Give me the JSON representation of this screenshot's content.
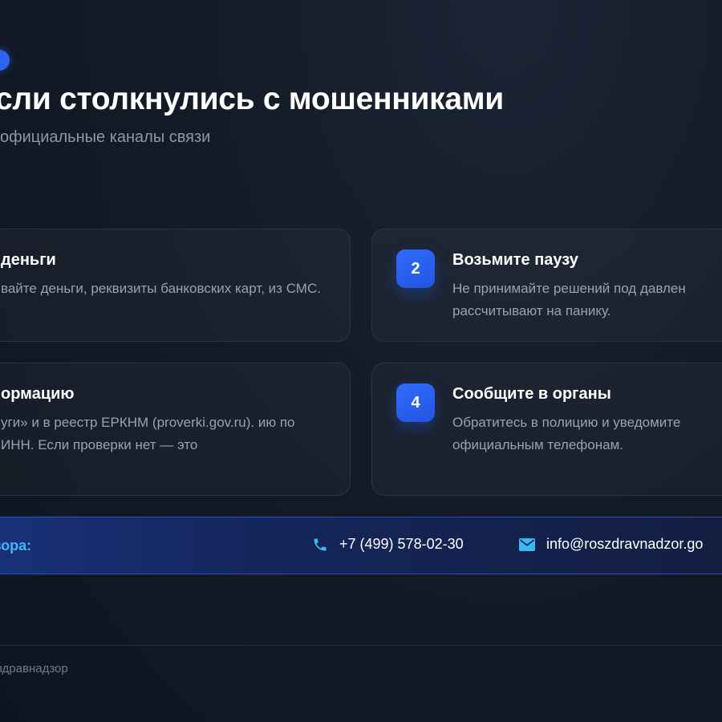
{
  "header": {
    "title": "сли столкнулись с мошенниками",
    "subtitle": "официальные каналы связи"
  },
  "cards": [
    {
      "number": "",
      "title": "деньги",
      "text": "вайте деньги, реквизиты банковских карт, из СМС."
    },
    {
      "number": "2",
      "title": "Возьмите паузу",
      "text_line_1": "Не принимайте решений под давлен",
      "text_line_2": "рассчитывают на панику."
    },
    {
      "number": "",
      "title": "ормацию",
      "text": "уги» и в реестр ЕРКНМ (proverki.gov.ru). ию по ИНН. Если проверки нет — это"
    },
    {
      "number": "4",
      "title": "Сообщите в органы",
      "text_line_1": "Обратитесь в полицию и уведомите",
      "text_line_2": "официальным телефонам."
    }
  ],
  "contacts": {
    "label": "адзора:",
    "phone": "+7 (499) 578-02-30",
    "email": "info@roszdravnadzor.go",
    "phone_icon": "phone-icon",
    "email_icon": "mail-icon",
    "accent_color": "#3db7f5"
  },
  "footer": {
    "text": "здравнадзор"
  },
  "colors": {
    "badge": "#2356e0",
    "background": "#141b28",
    "muted_text": "#97a2b5"
  }
}
